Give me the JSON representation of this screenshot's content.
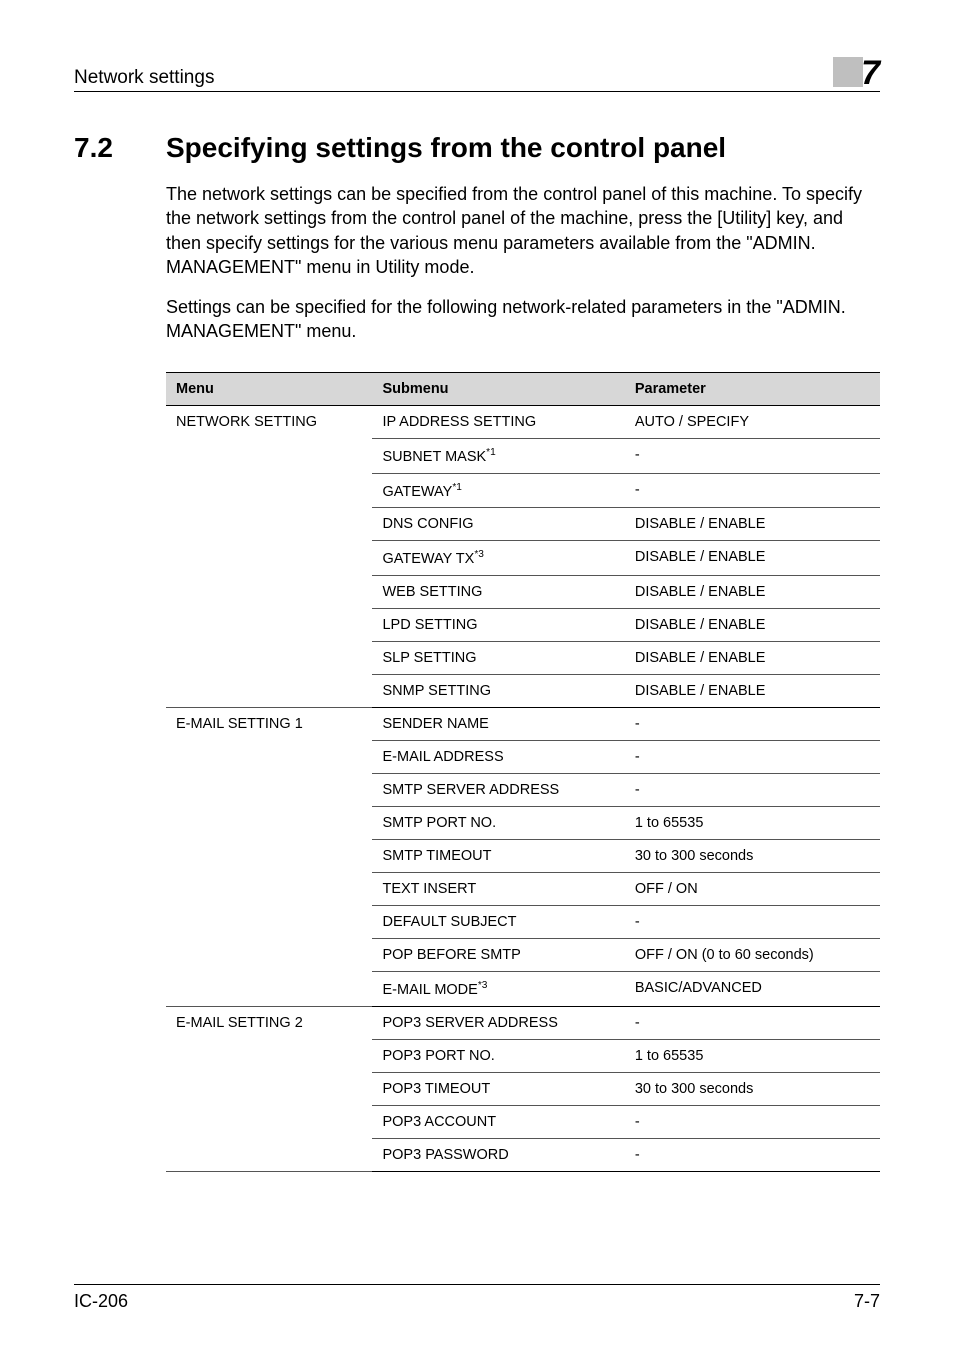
{
  "header": {
    "left": "Network settings",
    "chapter": "7"
  },
  "section": {
    "number": "7.2",
    "title": "Specifying settings from the control panel"
  },
  "paragraphs": {
    "p1": "The network settings can be specified from the control panel of this machine. To specify the network settings from the control panel of the machine, press the [Utility] key, and then specify settings for the various menu parameters available from the \"ADMIN. MANAGEMENT\" menu in Utility mode.",
    "p2": "Settings can be specified for the following network-related parameters in the \"ADMIN. MANAGEMENT\" menu."
  },
  "table": {
    "headers": {
      "menu": "Menu",
      "submenu": "Submenu",
      "parameter": "Parameter"
    },
    "groups": [
      {
        "menu": "NETWORK SETTING",
        "rows": [
          {
            "submenu": "IP ADDRESS SETTING",
            "sup": "",
            "parameter": "AUTO / SPECIFY"
          },
          {
            "submenu": "SUBNET MASK",
            "sup": "*1",
            "parameter": "-"
          },
          {
            "submenu": "GATEWAY",
            "sup": "*1",
            "parameter": "-"
          },
          {
            "submenu": "DNS CONFIG",
            "sup": "",
            "parameter": "DISABLE / ENABLE"
          },
          {
            "submenu": "GATEWAY TX",
            "sup": "*3",
            "parameter": "DISABLE / ENABLE"
          },
          {
            "submenu": "WEB SETTING",
            "sup": "",
            "parameter": "DISABLE / ENABLE"
          },
          {
            "submenu": "LPD SETTING",
            "sup": "",
            "parameter": "DISABLE / ENABLE"
          },
          {
            "submenu": "SLP SETTING",
            "sup": "",
            "parameter": "DISABLE / ENABLE"
          },
          {
            "submenu": "SNMP SETTING",
            "sup": "",
            "parameter": "DISABLE / ENABLE"
          }
        ]
      },
      {
        "menu": "E-MAIL SETTING 1",
        "rows": [
          {
            "submenu": "SENDER NAME",
            "sup": "",
            "parameter": "-"
          },
          {
            "submenu": "E-MAIL ADDRESS",
            "sup": "",
            "parameter": "-"
          },
          {
            "submenu": "SMTP SERVER ADDRESS",
            "sup": "",
            "parameter": "-"
          },
          {
            "submenu": "SMTP PORT NO.",
            "sup": "",
            "parameter": "1 to 65535"
          },
          {
            "submenu": "SMTP TIMEOUT",
            "sup": "",
            "parameter": "30 to 300 seconds"
          },
          {
            "submenu": "TEXT INSERT",
            "sup": "",
            "parameter": "OFF / ON"
          },
          {
            "submenu": "DEFAULT SUBJECT",
            "sup": "",
            "parameter": "-"
          },
          {
            "submenu": "POP BEFORE SMTP",
            "sup": "",
            "parameter": "OFF / ON (0 to 60 seconds)"
          },
          {
            "submenu": "E-MAIL MODE",
            "sup": "*3",
            "parameter": "BASIC/ADVANCED"
          }
        ]
      },
      {
        "menu": "E-MAIL SETTING 2",
        "rows": [
          {
            "submenu": "POP3 SERVER ADDRESS",
            "sup": "",
            "parameter": "-"
          },
          {
            "submenu": "POP3 PORT NO.",
            "sup": "",
            "parameter": "1 to 65535"
          },
          {
            "submenu": "POP3 TIMEOUT",
            "sup": "",
            "parameter": "30 to 300 seconds"
          },
          {
            "submenu": "POP3 ACCOUNT",
            "sup": "",
            "parameter": "-"
          },
          {
            "submenu": "POP3 PASSWORD",
            "sup": "",
            "parameter": "-"
          }
        ]
      }
    ]
  },
  "footer": {
    "left": "IC-206",
    "right": "7-7"
  }
}
